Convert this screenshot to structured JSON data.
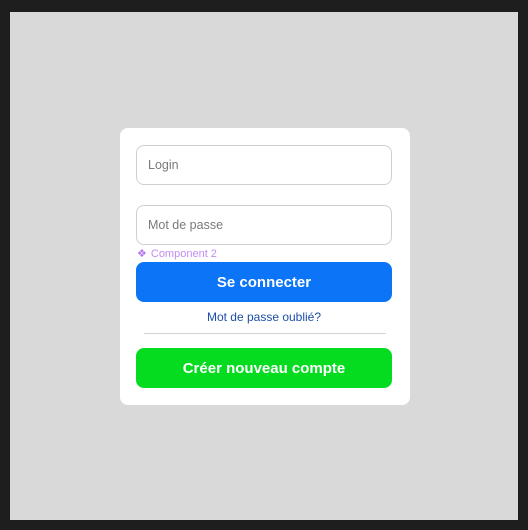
{
  "login_form": {
    "login_placeholder": "Login",
    "password_placeholder": "Mot de passe",
    "component_label": "Component 2",
    "component_icon": "component-diamond-icon",
    "login_button": "Se connecter",
    "forgot_password_link": "Mot de passe oublié?",
    "create_account_button": "Créer nouveau compte"
  },
  "colors": {
    "outer_frame": "#1e1e1e",
    "canvas": "#d9d9d9",
    "card": "#ffffff",
    "login_button": "#0b74f7",
    "create_account_button": "#06dc1f",
    "link": "#1c4fa8",
    "component_label": "#c38cf2"
  }
}
